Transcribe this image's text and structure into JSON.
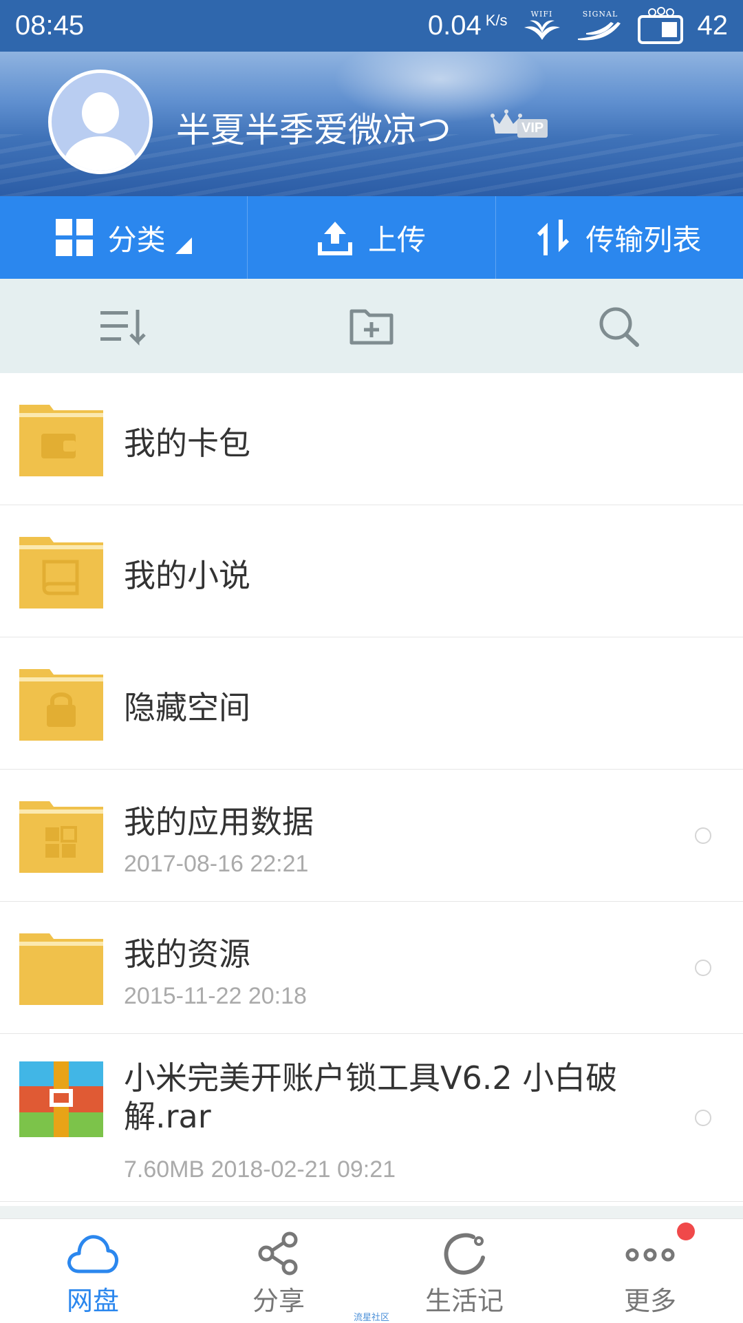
{
  "status_bar": {
    "time": "08:45",
    "speed": "0.04",
    "speed_unit": "K/s",
    "wifi_caption": "WIFI",
    "signal_caption": "SIGNAL",
    "battery": "42"
  },
  "profile": {
    "username": "半夏半季爱微凉つ",
    "vip_label": "VIP"
  },
  "action_bar": [
    {
      "label": "分类",
      "icon": "grid-icon"
    },
    {
      "label": "上传",
      "icon": "upload-icon"
    },
    {
      "label": "传输列表",
      "icon": "transfer-icon"
    }
  ],
  "toolbar": [
    "sort-icon",
    "new-folder-icon",
    "search-icon"
  ],
  "files": [
    {
      "name": "我的卡包",
      "meta": "",
      "type": "folder",
      "overlay": "wallet-icon"
    },
    {
      "name": "我的小说",
      "meta": "",
      "type": "folder",
      "overlay": "book-icon"
    },
    {
      "name": "隐藏空间",
      "meta": "",
      "type": "folder",
      "overlay": "lock-icon"
    },
    {
      "name": "我的应用数据",
      "meta": "2017-08-16  22:21",
      "type": "folder",
      "overlay": "apps-icon"
    },
    {
      "name": "我的资源",
      "meta": "2015-11-22  20:18",
      "type": "folder",
      "overlay": ""
    },
    {
      "name": "小米完美开账户锁工具V6.2  小白破解.rar",
      "meta": "7.60MB   2018-02-21  09:21",
      "type": "archive"
    }
  ],
  "bottom_nav": [
    {
      "label": "网盘",
      "icon": "cloud-icon",
      "active": true
    },
    {
      "label": "分享",
      "icon": "share-icon"
    },
    {
      "label": "生活记",
      "icon": "refresh-icon"
    },
    {
      "label": "更多",
      "icon": "more-icon",
      "badge": true
    }
  ],
  "watermark": "流星社区",
  "colors": {
    "status_bar": "#2f67ad",
    "action_bar": "#2b87ee",
    "toolbar": "#e5eff0",
    "folder": "#f0c14b",
    "active": "#2b87ee",
    "badge": "#f0494a"
  }
}
